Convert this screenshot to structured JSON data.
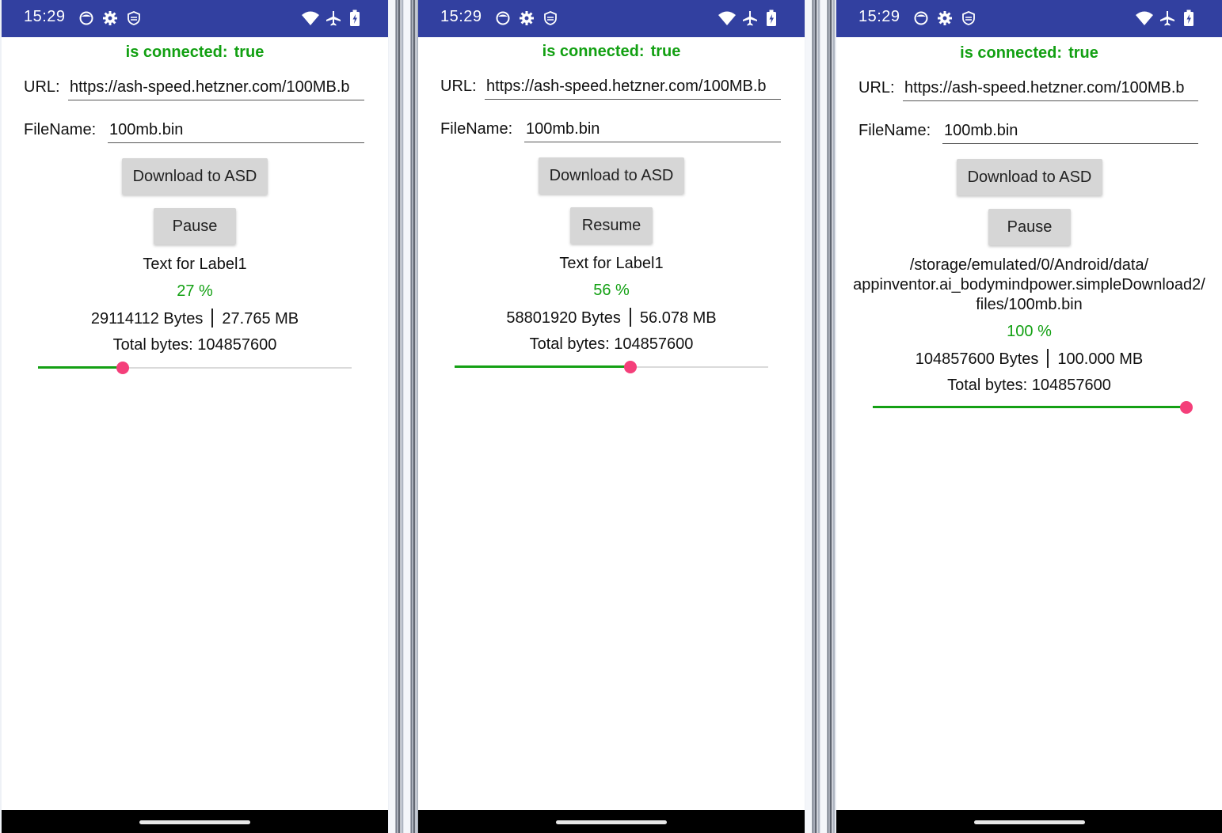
{
  "colors": {
    "statusbar": "#3240a0",
    "connected_green": "#12a012",
    "slider_thumb": "#f43f7a",
    "slider_fill": "#14a014",
    "button_bg": "#d6d6d6"
  },
  "screens": [
    {
      "status": {
        "time": "15:29",
        "icons_left": [
          "app-icon",
          "gear-icon",
          "shield-icon"
        ],
        "icons_right": [
          "wifi-icon",
          "airplane-icon",
          "battery-icon"
        ]
      },
      "connected": {
        "label": "is connected:",
        "value": "true"
      },
      "url": {
        "label": "URL:",
        "value": "https://ash-speed.hetzner.com/100MB.b"
      },
      "filename": {
        "label": "FileName:",
        "value": "100mb.bin"
      },
      "download_button": "Download to ASD",
      "pause_button": "Pause",
      "label_lines": [
        "Text for Label1"
      ],
      "percent": "27 %",
      "bytes": "29114112 Bytes",
      "mb": "27.765 MB",
      "total": "Total bytes: 104857600",
      "progress": 0.27
    },
    {
      "status": {
        "time": "15:29",
        "icons_left": [
          "app-icon",
          "gear-icon",
          "shield-icon"
        ],
        "icons_right": [
          "wifi-icon",
          "airplane-icon",
          "battery-icon"
        ]
      },
      "connected": {
        "label": "is connected:",
        "value": "true"
      },
      "url": {
        "label": "URL:",
        "value": "https://ash-speed.hetzner.com/100MB.b"
      },
      "filename": {
        "label": "FileName:",
        "value": "100mb.bin"
      },
      "download_button": "Download to ASD",
      "pause_button": "Resume",
      "label_lines": [
        "Text for Label1"
      ],
      "percent": "56 %",
      "bytes": "58801920 Bytes",
      "mb": "56.078 MB",
      "total": "Total bytes: 104857600",
      "progress": 0.56
    },
    {
      "status": {
        "time": "15:29",
        "icons_left": [
          "app-icon",
          "gear-icon",
          "shield-icon"
        ],
        "icons_right": [
          "wifi-icon",
          "airplane-icon",
          "battery-icon"
        ]
      },
      "connected": {
        "label": "is connected:",
        "value": "true"
      },
      "url": {
        "label": "URL:",
        "value": "https://ash-speed.hetzner.com/100MB.b"
      },
      "filename": {
        "label": "FileName:",
        "value": "100mb.bin"
      },
      "download_button": "Download to ASD",
      "pause_button": "Pause",
      "label_lines": [
        "/storage/emulated/0/Android/data/",
        "appinventor.ai_bodymindpower.simpleDownload2/",
        "files/100mb.bin"
      ],
      "percent": "100 %",
      "bytes": "104857600 Bytes",
      "mb": "100.000 MB",
      "total": "Total bytes: 104857600",
      "progress": 1.0
    }
  ]
}
